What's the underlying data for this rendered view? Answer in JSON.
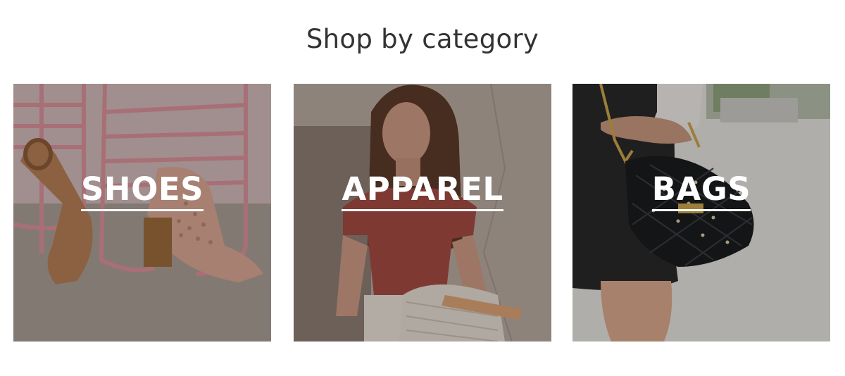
{
  "section": {
    "title": "Shop by category"
  },
  "categories": [
    {
      "label": "SHOES"
    },
    {
      "label": "APPAREL"
    },
    {
      "label": "BAGS"
    }
  ],
  "colors": {
    "heading_text": "#333333",
    "label_text": "#ffffff",
    "shoes_bg": "#c9b7b3",
    "apparel_bg": "#b9a99e",
    "bags_bg": "#d8d6d3"
  }
}
